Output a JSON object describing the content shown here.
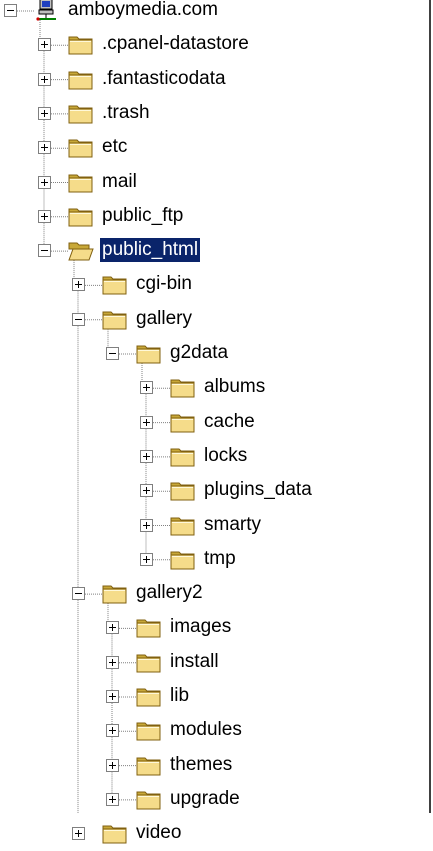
{
  "colors": {
    "selection": "#0a246a",
    "folder": "#f5dc8a",
    "folder_dark": "#c8a838"
  },
  "tree": [
    {
      "label": "amboymedia.com",
      "depth": 0,
      "state": "expanded",
      "icon": "computer-icon"
    },
    {
      "label": ".cpanel-datastore",
      "depth": 1,
      "state": "collapsed",
      "icon": "folder-icon"
    },
    {
      "label": ".fantasticodata",
      "depth": 1,
      "state": "collapsed",
      "icon": "folder-icon"
    },
    {
      "label": ".trash",
      "depth": 1,
      "state": "collapsed",
      "icon": "folder-icon"
    },
    {
      "label": "etc",
      "depth": 1,
      "state": "collapsed",
      "icon": "folder-icon"
    },
    {
      "label": "mail",
      "depth": 1,
      "state": "collapsed",
      "icon": "folder-icon"
    },
    {
      "label": "public_ftp",
      "depth": 1,
      "state": "collapsed",
      "icon": "folder-icon"
    },
    {
      "label": "public_html",
      "depth": 1,
      "state": "expanded",
      "icon": "open-folder-icon",
      "selected": true
    },
    {
      "label": "cgi-bin",
      "depth": 2,
      "state": "collapsed",
      "icon": "folder-icon"
    },
    {
      "label": "gallery",
      "depth": 2,
      "state": "expanded",
      "icon": "folder-icon"
    },
    {
      "label": "g2data",
      "depth": 3,
      "state": "expanded",
      "icon": "folder-icon"
    },
    {
      "label": "albums",
      "depth": 4,
      "state": "collapsed",
      "icon": "folder-icon"
    },
    {
      "label": "cache",
      "depth": 4,
      "state": "collapsed",
      "icon": "folder-icon"
    },
    {
      "label": "locks",
      "depth": 4,
      "state": "collapsed",
      "icon": "folder-icon"
    },
    {
      "label": "plugins_data",
      "depth": 4,
      "state": "collapsed",
      "icon": "folder-icon"
    },
    {
      "label": "smarty",
      "depth": 4,
      "state": "collapsed",
      "icon": "folder-icon"
    },
    {
      "label": "tmp",
      "depth": 4,
      "state": "collapsed",
      "icon": "folder-icon"
    },
    {
      "label": "gallery2",
      "depth": 2,
      "state": "expanded",
      "icon": "folder-icon"
    },
    {
      "label": "images",
      "depth": 3,
      "state": "collapsed",
      "icon": "folder-icon"
    },
    {
      "label": "install",
      "depth": 3,
      "state": "collapsed",
      "icon": "folder-icon"
    },
    {
      "label": "lib",
      "depth": 3,
      "state": "collapsed",
      "icon": "folder-icon"
    },
    {
      "label": "modules",
      "depth": 3,
      "state": "collapsed",
      "icon": "folder-icon"
    },
    {
      "label": "themes",
      "depth": 3,
      "state": "collapsed",
      "icon": "folder-icon"
    },
    {
      "label": "upgrade",
      "depth": 3,
      "state": "collapsed",
      "icon": "folder-icon"
    },
    {
      "label": "video",
      "depth": 2,
      "state": "collapsed",
      "icon": "folder-icon"
    }
  ]
}
